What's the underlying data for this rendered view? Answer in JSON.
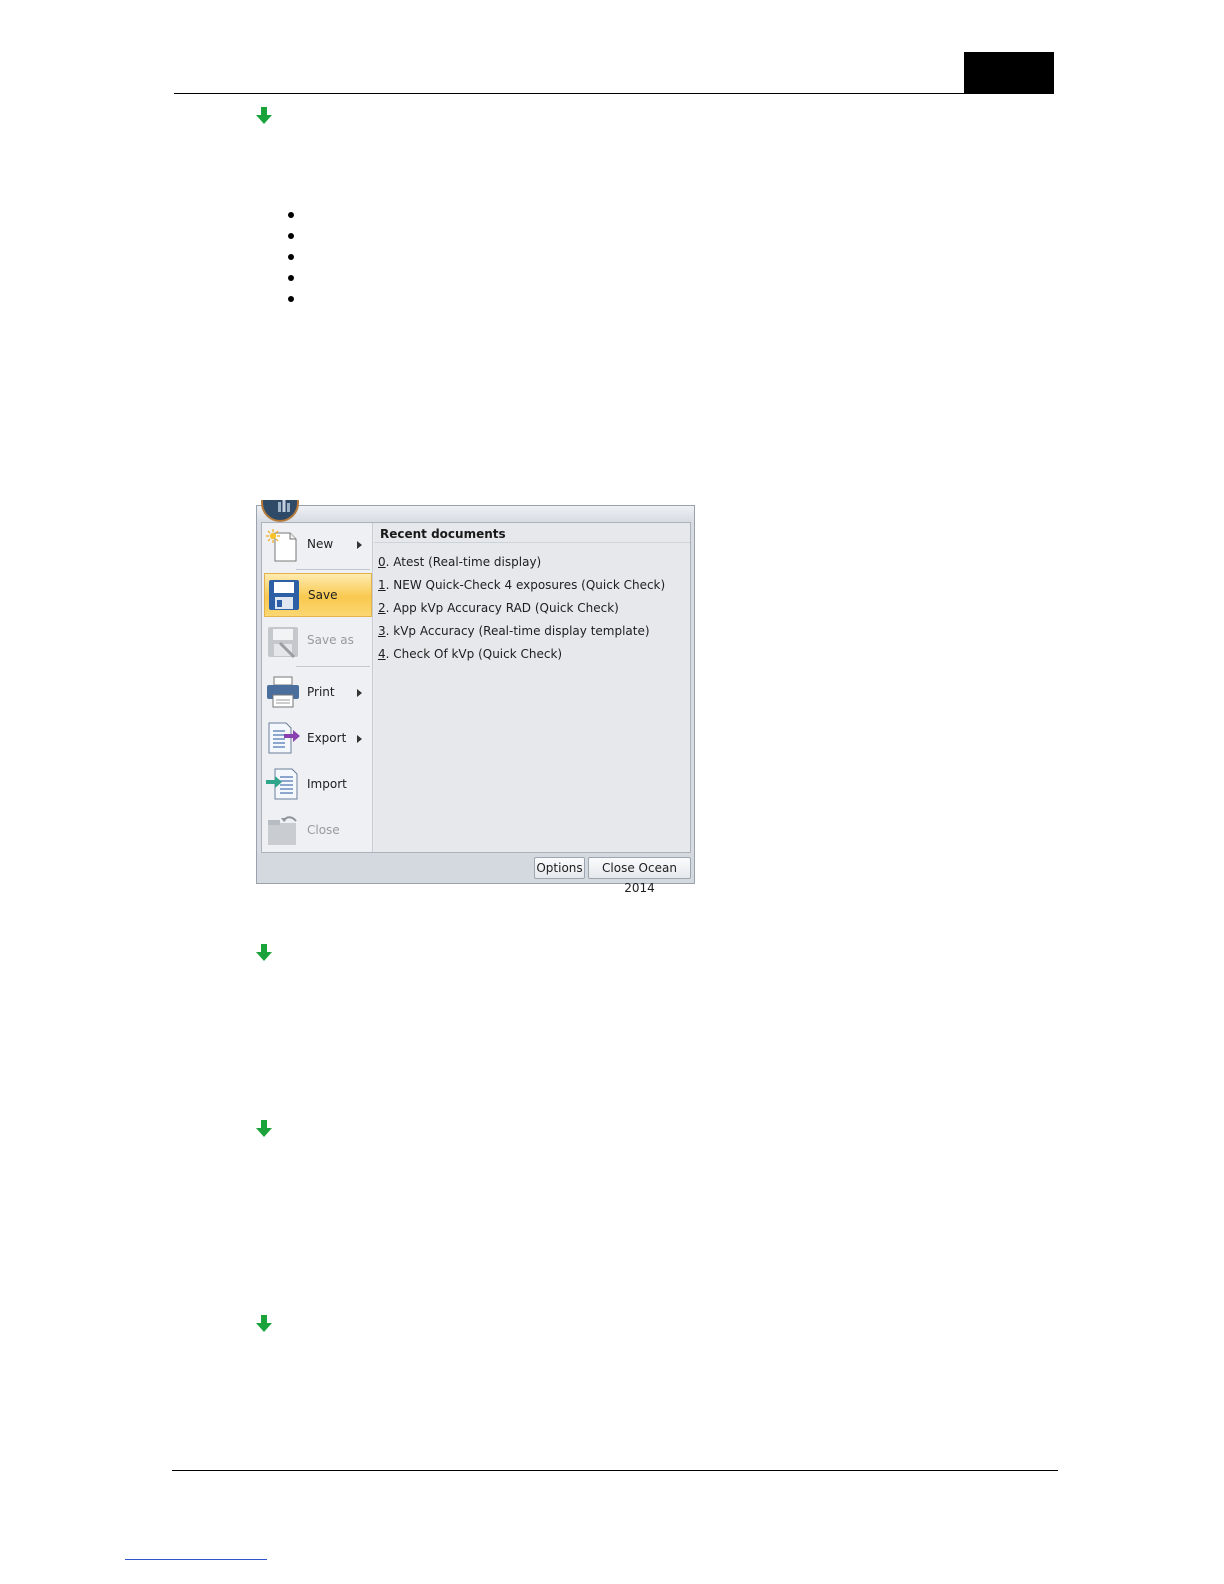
{
  "menu": {
    "items": [
      {
        "label": "New",
        "has_submenu": true,
        "enabled": true,
        "icon": "new-document-icon"
      },
      {
        "label": "Save",
        "has_submenu": false,
        "enabled": true,
        "selected": true,
        "icon": "save-icon"
      },
      {
        "label": "Save as",
        "has_submenu": false,
        "enabled": false,
        "icon": "save-as-icon"
      },
      {
        "label": "Print",
        "has_submenu": true,
        "enabled": true,
        "icon": "printer-icon"
      },
      {
        "label": "Export",
        "has_submenu": true,
        "enabled": true,
        "icon": "export-icon"
      },
      {
        "label": "Import",
        "has_submenu": false,
        "enabled": true,
        "icon": "import-icon"
      },
      {
        "label": "Close",
        "has_submenu": false,
        "enabled": false,
        "icon": "close-folder-icon"
      }
    ]
  },
  "recent": {
    "title": "Recent documents",
    "items": [
      {
        "num": "0",
        "text": ". Atest (Real-time display)"
      },
      {
        "num": "1",
        "text": ". NEW Quick-Check 4 exposures (Quick Check)"
      },
      {
        "num": "2",
        "text": ". App kVp Accuracy RAD (Quick Check)"
      },
      {
        "num": "3",
        "text": ". kVp Accuracy (Real-time display template)"
      },
      {
        "num": "4",
        "text": ". Check Of kVp (Quick Check)"
      }
    ]
  },
  "buttons": {
    "options": "Options",
    "close_app": "Close Ocean 2014"
  },
  "colors": {
    "arrow": "#1aa33a",
    "selected_item": "#f9c94f"
  }
}
